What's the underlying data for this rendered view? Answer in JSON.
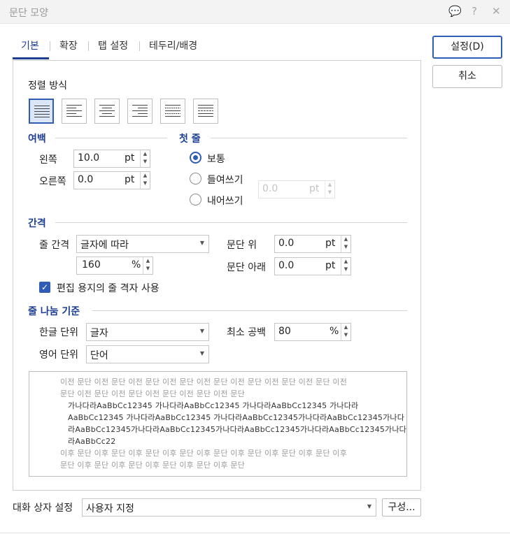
{
  "window": {
    "title": "문단 모양"
  },
  "titlebar_icons": [
    "comment-icon",
    "help-icon",
    "close-icon"
  ],
  "titlebar_glyphs": {
    "comment": "💬",
    "help": "?",
    "close": "✕"
  },
  "tabs": [
    {
      "label": "기본",
      "active": true
    },
    {
      "label": "확장",
      "active": false
    },
    {
      "label": "탭 설정",
      "active": false
    },
    {
      "label": "테두리/배경",
      "active": false
    }
  ],
  "buttons": {
    "ok": "설정(D)",
    "cancel": "취소",
    "config": "구성..."
  },
  "alignment": {
    "label": "정렬 방식",
    "options": [
      "justify",
      "left",
      "center",
      "right",
      "distribute",
      "divide"
    ],
    "selected": "justify"
  },
  "margins": {
    "title": "여백",
    "left_label": "왼쪽",
    "left_value": "10.0",
    "left_unit": "pt",
    "right_label": "오른쪽",
    "right_value": "0.0",
    "right_unit": "pt"
  },
  "first_line": {
    "title": "첫 줄",
    "options": [
      "보통",
      "들여쓰기",
      "내어쓰기"
    ],
    "selected": "보통",
    "value": "0.0",
    "unit": "pt"
  },
  "spacing": {
    "title": "간격",
    "line_label": "줄 간격",
    "line_mode": "글자에 따라",
    "line_value": "160",
    "line_unit": "%",
    "above_label": "문단 위",
    "above_value": "0.0",
    "above_unit": "pt",
    "below_label": "문단 아래",
    "below_value": "0.0",
    "below_unit": "pt",
    "grid_label": "편집 용지의 줄 격자 사용",
    "grid_checked": true
  },
  "line_break": {
    "title": "줄 나눔 기준",
    "korean_label": "한글 단위",
    "korean_value": "글자",
    "english_label": "영어 단위",
    "english_value": "단어",
    "min_space_label": "최소 공백",
    "min_space_value": "80",
    "min_space_unit": "%"
  },
  "preview": {
    "prev_lines": [
      "이전 문단 이전 문단 이전 문단 이전 문단 이전 문단 이전 문단 이전 문단 이전 문단 이전",
      "문단 이전 문단 이전 문단 이전 문단 이전 문단 이전 문단"
    ],
    "cur_lines": [
      "가나다라AaBbCc12345     가나다라AaBbCc12345     가나다라AaBbCc12345     가나다라",
      "AaBbCc12345  가나다라AaBbCc12345  가나다라AaBbCc12345가나다라AaBbCc12345가나다",
      "라AaBbCc12345가나다라AaBbCc12345가나다라AaBbCc12345가나다라AaBbCc12345가나다",
      "라AaBbCc22"
    ],
    "next_lines": [
      "이후 문단 이후 문단 이후 문단 이후 문단 이후 문단 이후 문단 이후 문단 이후 문단 이후",
      "문단 이후 문단 이후 문단 이후 문단 이후 문단 이후 문단"
    ]
  },
  "footer": {
    "label": "대화 상자 설정",
    "value": "사용자 지정"
  }
}
